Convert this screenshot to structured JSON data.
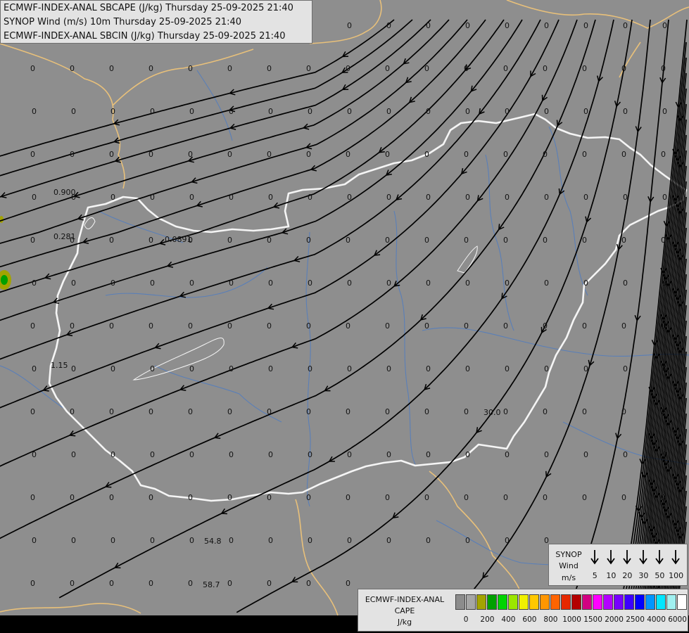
{
  "header": {
    "lines": [
      "ECMWF-INDEX-ANAL SBCAPE (J/kg) Thursday 25-09-2025 21:40",
      "SYNOP Wind (m/s) 10m Thursday 25-09-2025 21:40",
      "ECMWF-INDEX-ANAL SBCIN (J/kg) Thursday 25-09-2025 21:40"
    ]
  },
  "wind_legend": {
    "title_1": "SYNOP",
    "title_2": "Wind",
    "unit": "m/s",
    "speeds": [
      "5",
      "10",
      "20",
      "30",
      "50",
      "100"
    ]
  },
  "cape_legend": {
    "title": "ECMWF-INDEX-ANAL",
    "field": "CAPE",
    "unit": "J/kg",
    "ticks": [
      "0",
      "200",
      "400",
      "600",
      "800",
      "1000",
      "1500",
      "2000",
      "2500",
      "4000",
      "6000"
    ],
    "colors": [
      "#8c8c8c",
      "#a6a6a6",
      "#a3a300",
      "#00a000",
      "#00d400",
      "#9be600",
      "#f0f000",
      "#ffc800",
      "#ff9600",
      "#ff6400",
      "#e62800",
      "#b40000",
      "#d20082",
      "#ff00ff",
      "#b400ff",
      "#7800ff",
      "#3c00ff",
      "#0000ff",
      "#0096ff",
      "#00e6ff",
      "#a0f0f0",
      "#ffffff"
    ]
  },
  "map_colors": {
    "background": "#8e8e8e",
    "border": "#f5f5f5",
    "neighbor_border": "#e8c07a",
    "river": "#5a7fb8",
    "streamline": "#000000"
  },
  "cin_labels": [
    "0.900",
    "0.281",
    "0.0891",
    "1.15",
    "30.0",
    "54.8",
    "58.7"
  ],
  "grid_value": "0"
}
